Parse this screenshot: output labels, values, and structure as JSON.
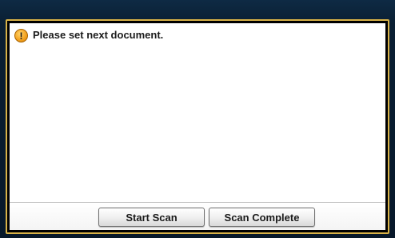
{
  "dialog": {
    "icon": "warning-info-icon",
    "message": "Please set next document."
  },
  "buttons": {
    "start_scan_label": "Start Scan",
    "scan_complete_label": "Scan Complete"
  },
  "colors": {
    "frame_border": "#d8b248",
    "screen_background": "#0a1f33",
    "warning_icon": "#f4a422"
  }
}
